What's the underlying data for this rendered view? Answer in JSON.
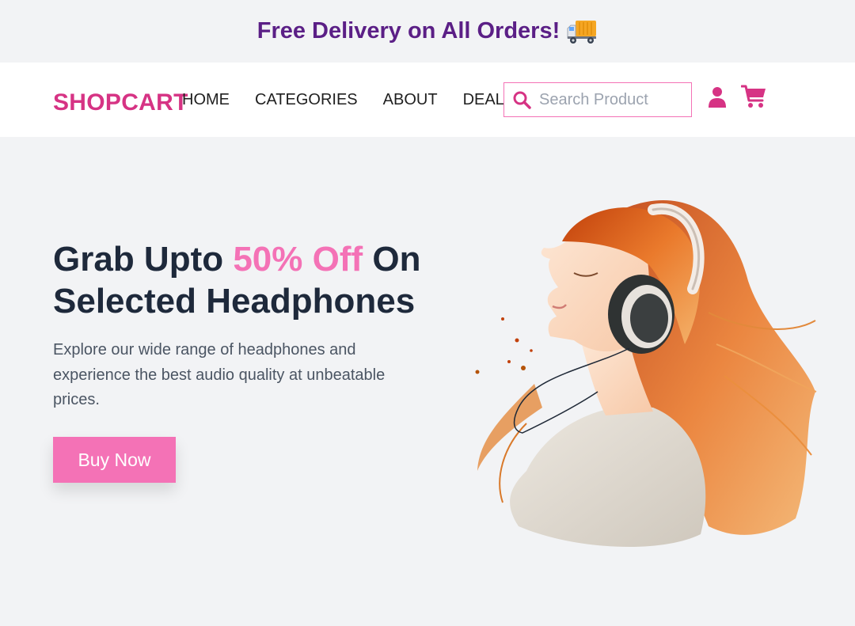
{
  "promo": {
    "text": "Free Delivery on All Orders!",
    "icon": "delivery-truck-icon"
  },
  "header": {
    "logo": "SHOPCART",
    "nav": [
      {
        "label": "HOME"
      },
      {
        "label": "CATEGORIES"
      },
      {
        "label": "ABOUT"
      },
      {
        "label": "DEALS"
      }
    ],
    "search": {
      "placeholder": "Search Product",
      "value": "",
      "icon": "search-icon"
    },
    "icons": [
      "user-icon",
      "cart-icon"
    ]
  },
  "hero": {
    "title_part1": "Grab Upto ",
    "title_accent": "50% Off",
    "title_part2": " On Selected Headphones",
    "description": "Explore our wide range of headphones and experience the best audio quality at unbeatable prices.",
    "button": "Buy Now",
    "image_icon": "woman-with-headphones-illustration"
  },
  "colors": {
    "brand": "#d63384",
    "accent": "#f472b6",
    "promo_text": "#5b1f86",
    "heading": "#1e293b",
    "background": "#f2f3f5"
  }
}
